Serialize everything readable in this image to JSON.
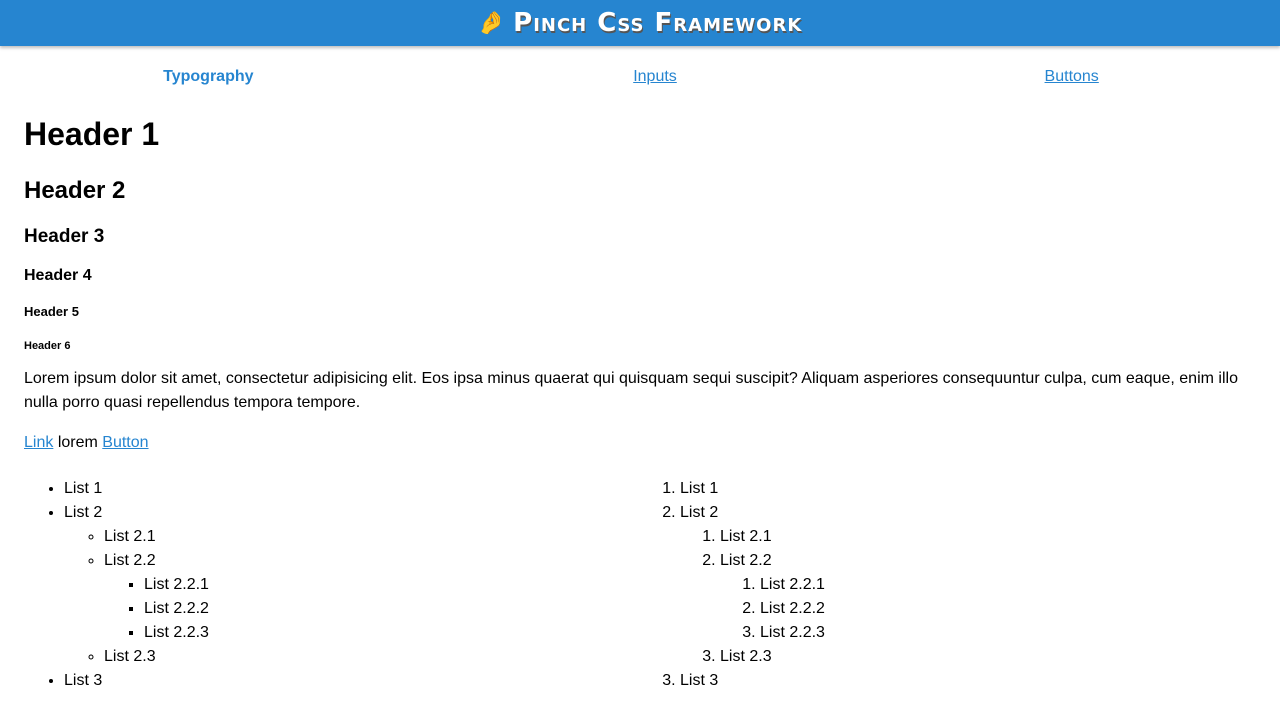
{
  "header": {
    "emoji": "🤌",
    "title": "Pinch Css Framework",
    "color": "#2685d0"
  },
  "nav": [
    "Typography",
    "Inputs",
    "Buttons"
  ],
  "headings": [
    "Header 1",
    "Header 2",
    "Header 3",
    "Header 4",
    "Header 5",
    "Header 6"
  ],
  "paragraph": "Lorem ipsum dolor sit amet, consectetur adipisicing elit. Eos ipsa minus quaerat qui quisquam sequi suscipit? Aliquam asperiores consequuntur culpa, cum eaque, enim illo nulla porro quasi repellendus tempora tempore.",
  "links": {
    "link": "Link",
    "text": "lorem",
    "button": "Button"
  },
  "list": {
    "l1": "List 1",
    "l2": "List 2",
    "l21": "List 2.1",
    "l22": "List 2.2",
    "l221": "List 2.2.1",
    "l222": "List 2.2.2",
    "l223": "List 2.2.3",
    "l23": "List 2.3",
    "l3": "List 3"
  }
}
